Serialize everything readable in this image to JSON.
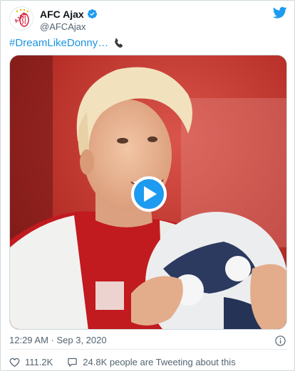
{
  "author": {
    "display_name": "AFC Ajax",
    "handle": "@AFCAjax",
    "avatar_text": "AJAX"
  },
  "tweet": {
    "text": "#DreamLikeDonny…"
  },
  "meta": {
    "timestamp": "12:29 AM · Sep 3, 2020"
  },
  "actions": {
    "like_count": "111.2K",
    "conversation_label": "24.8K people are Tweeting about this"
  },
  "colors": {
    "brand_blue": "#1d9bf0",
    "hashtag_blue": "#1b95e0",
    "ajax_red": "#d2122e",
    "like_red": "#e0245e"
  },
  "icons": [
    "verified-icon",
    "twitter-logo-icon",
    "telephone-icon",
    "play-icon",
    "info-icon",
    "heart-icon",
    "speech-bubble-icon"
  ]
}
